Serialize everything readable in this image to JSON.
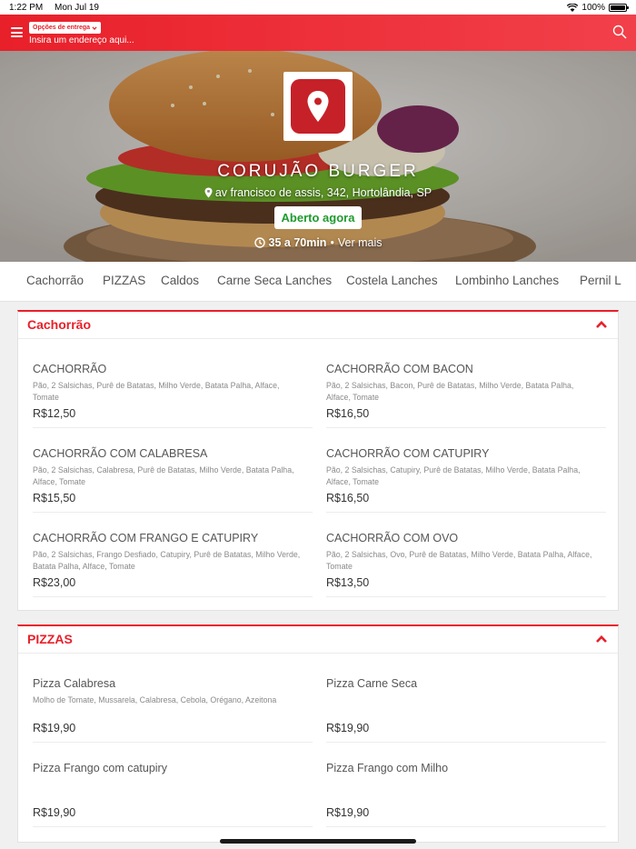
{
  "status_bar": {
    "time": "1:22 PM",
    "date": "Mon Jul 19",
    "battery": "100%"
  },
  "header": {
    "delivery_options_label": "Opções de entrega",
    "address_placeholder": "Insira um endereço aqui..."
  },
  "store": {
    "name": "CORUJÃO BURGER",
    "address": "av francisco de assis, 342, Hortolândia, SP",
    "status": "Aberto agora",
    "delivery_time": "35 a 70min",
    "separator": "•",
    "see_more": "Ver mais"
  },
  "categories": [
    "Cachorrão",
    "PIZZAS",
    "Caldos",
    "Carne Seca Lanches",
    "Costela Lanches",
    "Lombinho Lanches",
    "Pernil L"
  ],
  "sections": [
    {
      "title": "Cachorrão",
      "items": [
        {
          "name": "CACHORRÃO",
          "desc": "Pão, 2 Salsichas, Purê de Batatas, Milho Verde, Batata Palha, Alface, Tomate",
          "price": "R$12,50"
        },
        {
          "name": "CACHORRÃO COM BACON",
          "desc": "Pão, 2 Salsichas, Bacon, Purê de Batatas, Milho Verde, Batata Palha, Alface, Tomate",
          "price": "R$16,50"
        },
        {
          "name": "CACHORRÃO COM CALABRESA",
          "desc": "Pão, 2 Salsichas, Calabresa, Purê de Batatas, Milho Verde, Batata Palha, Alface, Tomate",
          "price": "R$15,50"
        },
        {
          "name": "CACHORRÃO COM CATUPIRY",
          "desc": "Pão, 2 Salsichas, Catupiry, Purê de Batatas, Milho Verde, Batata Palha, Alface, Tomate",
          "price": "R$16,50"
        },
        {
          "name": "CACHORRÃO COM FRANGO E CATUPIRY",
          "desc": "Pão, 2 Salsichas, Frango Desfiado, Catupiry, Purê de Batatas, Milho Verde, Batata Palha, Alface, Tomate",
          "price": "R$23,00"
        },
        {
          "name": "CACHORRÃO COM OVO",
          "desc": "Pão, 2 Salsichas, Ovo, Purê de Batatas, Milho Verde, Batata Palha, Alface, Tomate",
          "price": "R$13,50"
        }
      ]
    },
    {
      "title": "PIZZAS",
      "items": [
        {
          "name": "Pizza Calabresa",
          "desc": "Molho de Tomate, Mussarela, Calabresa, Cebola, Orégano, Azeitona",
          "price": "R$19,90"
        },
        {
          "name": "Pizza Carne Seca",
          "desc": "",
          "price": "R$19,90"
        },
        {
          "name": "Pizza Frango com catupiry",
          "desc": "",
          "price": "R$19,90"
        },
        {
          "name": "Pizza Frango com Milho",
          "desc": "",
          "price": "R$19,90"
        }
      ]
    }
  ],
  "colors": {
    "accent": "#e8202a",
    "open": "#1e9b2e",
    "logo": "#c62128"
  },
  "icons": {
    "menu": "hamburger-icon",
    "search": "search-icon",
    "location": "map-pin-icon",
    "clock": "clock-icon",
    "collapse": "chevron-up-icon"
  }
}
